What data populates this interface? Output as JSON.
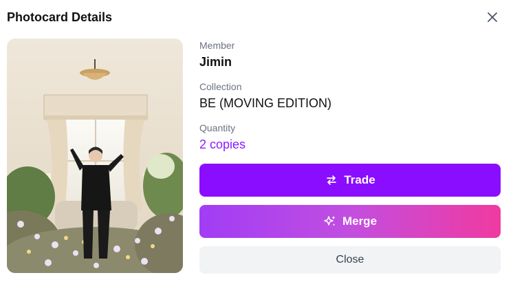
{
  "dialog": {
    "title": "Photocard Details"
  },
  "icons": {
    "close": "close-icon",
    "trade": "swap-arrows-icon",
    "merge": "sparkles-icon"
  },
  "details": {
    "member_label": "Member",
    "member_value": "Jimin",
    "collection_label": "Collection",
    "collection_value": "BE (MOVING EDITION)",
    "quantity_label": "Quantity",
    "quantity_value": "2 copies"
  },
  "actions": {
    "trade_label": "Trade",
    "merge_label": "Merge",
    "close_label": "Close"
  },
  "colors": {
    "accent": "#8b0dff",
    "merge_gradient_start": "#a13df5",
    "merge_gradient_end": "#f03aa0",
    "close_bg": "#f2f3f5"
  }
}
